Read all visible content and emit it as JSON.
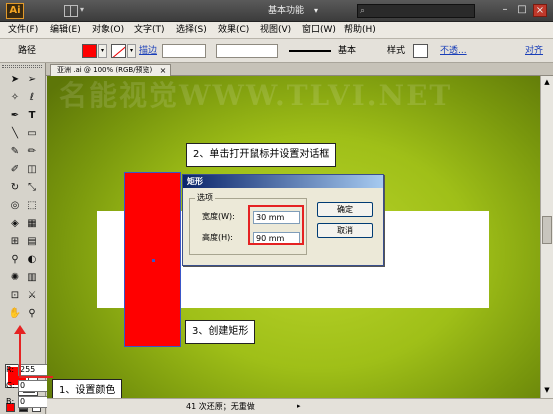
{
  "titlebar": {
    "logo": "Ai",
    "workspace": "基本功能",
    "window_buttons": [
      "–",
      "□",
      "×"
    ]
  },
  "menu": [
    "文件(F)",
    "编辑(E)",
    "对象(O)",
    "文字(T)",
    "选择(S)",
    "效果(C)",
    "视图(V)",
    "窗口(W)",
    "帮助(H)"
  ],
  "control": {
    "selection_label": "路径",
    "fill_color": "#ff0000",
    "stroke_label": "描边",
    "stroke_style": "基本",
    "style_label": "样式",
    "opacity_label": "不透...",
    "align_label": "对齐"
  },
  "document_tab": {
    "title": "亚洲 .ai @ 100% (RGB/预览)",
    "close": "×"
  },
  "watermark": "名能视觉WWW.TLVI.NET",
  "dialog": {
    "title": "矩形",
    "group_label": "选项",
    "width_label": "宽度(W):",
    "width_value": "30 mm",
    "height_label": "高度(H):",
    "height_value": "90 mm",
    "ok_label": "确定",
    "cancel_label": "取消"
  },
  "callouts": {
    "step1": "1、设置颜色",
    "step2": "2、单击打开鼠标并设置对话框",
    "step3": "3、创建矩形"
  },
  "color_panel": {
    "r_label": "R:",
    "r_value": "255",
    "g_label": "G:",
    "g_value": "0",
    "b_label": "B:",
    "b_value": "0"
  },
  "status": {
    "text": "41 次还原；无重做"
  },
  "colors": {
    "fill": "#ff0000",
    "highlight": "#e52222",
    "canvas": "#9fbf18"
  }
}
